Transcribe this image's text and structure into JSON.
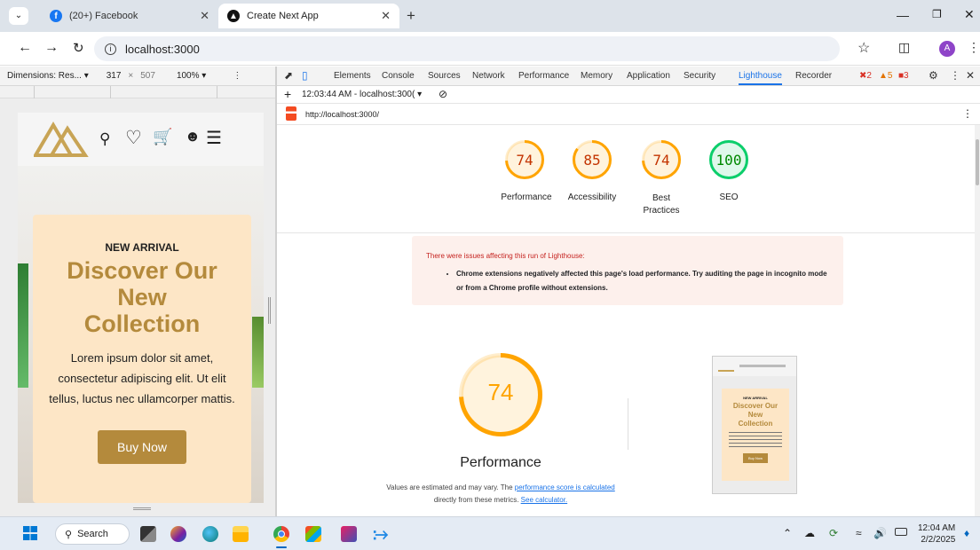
{
  "browser": {
    "tabs": [
      {
        "label": "(20+) Facebook",
        "active": false,
        "icon": "facebook-icon"
      },
      {
        "label": "Create Next App",
        "active": true,
        "icon": "nextjs-icon"
      }
    ],
    "address": "localhost:3000",
    "profile_initial": "A"
  },
  "device_toolbar": {
    "dimensions_label": "Dimensions: Res... ▾",
    "width": "317",
    "times": "×",
    "height": "507",
    "zoom": "100% ▾"
  },
  "mobile_page": {
    "kicker": "NEW ARRIVAL",
    "title_lines": [
      "Discover Our",
      "New",
      "Collection"
    ],
    "body": "Lorem ipsum dolor sit amet, consectetur adipiscing elit. Ut elit tellus, luctus nec ullamcorper mattis.",
    "button": "Buy Now"
  },
  "devtools": {
    "tabs": [
      "Elements",
      "Console",
      "Sources",
      "Network",
      "Performance",
      "Memory",
      "Application",
      "Security",
      "Lighthouse",
      "Recorder"
    ],
    "active_tab": "Lighthouse",
    "errors": "2",
    "warnings": "5",
    "issues": "3",
    "report_selector": "12:03:44 AM - localhost:300( ▾",
    "url": "http://localhost:3000/"
  },
  "lighthouse": {
    "scores": [
      {
        "label": "Performance",
        "value": 74,
        "color": "#ffa400"
      },
      {
        "label": "Accessibility",
        "value": 85,
        "color": "#ffa400"
      },
      {
        "label": "Best Practices",
        "value": 74,
        "color": "#ffa400"
      },
      {
        "label": "SEO",
        "value": 100,
        "color": "#0cce6b"
      }
    ],
    "warning_title": "There were issues affecting this run of Lighthouse:",
    "warning_item": "Chrome extensions negatively affected this page's load performance. Try auditing the page in incognito mode or from a Chrome profile without extensions.",
    "main_score": {
      "value": 74,
      "label": "Performance",
      "color": "#ffa400"
    },
    "note_prefix": "Values are estimated and may vary. The ",
    "note_link1": "performance score is calculated",
    "note_middle": " directly from these metrics. ",
    "note_link2": "See calculator."
  },
  "thumbnail": {
    "kicker": "NEW ARRIVAL",
    "title": "Discover Our New Collection",
    "button": "Buy Now"
  },
  "taskbar": {
    "search_label": "Search",
    "time": "12:04 AM",
    "date": "2/2/2025"
  }
}
